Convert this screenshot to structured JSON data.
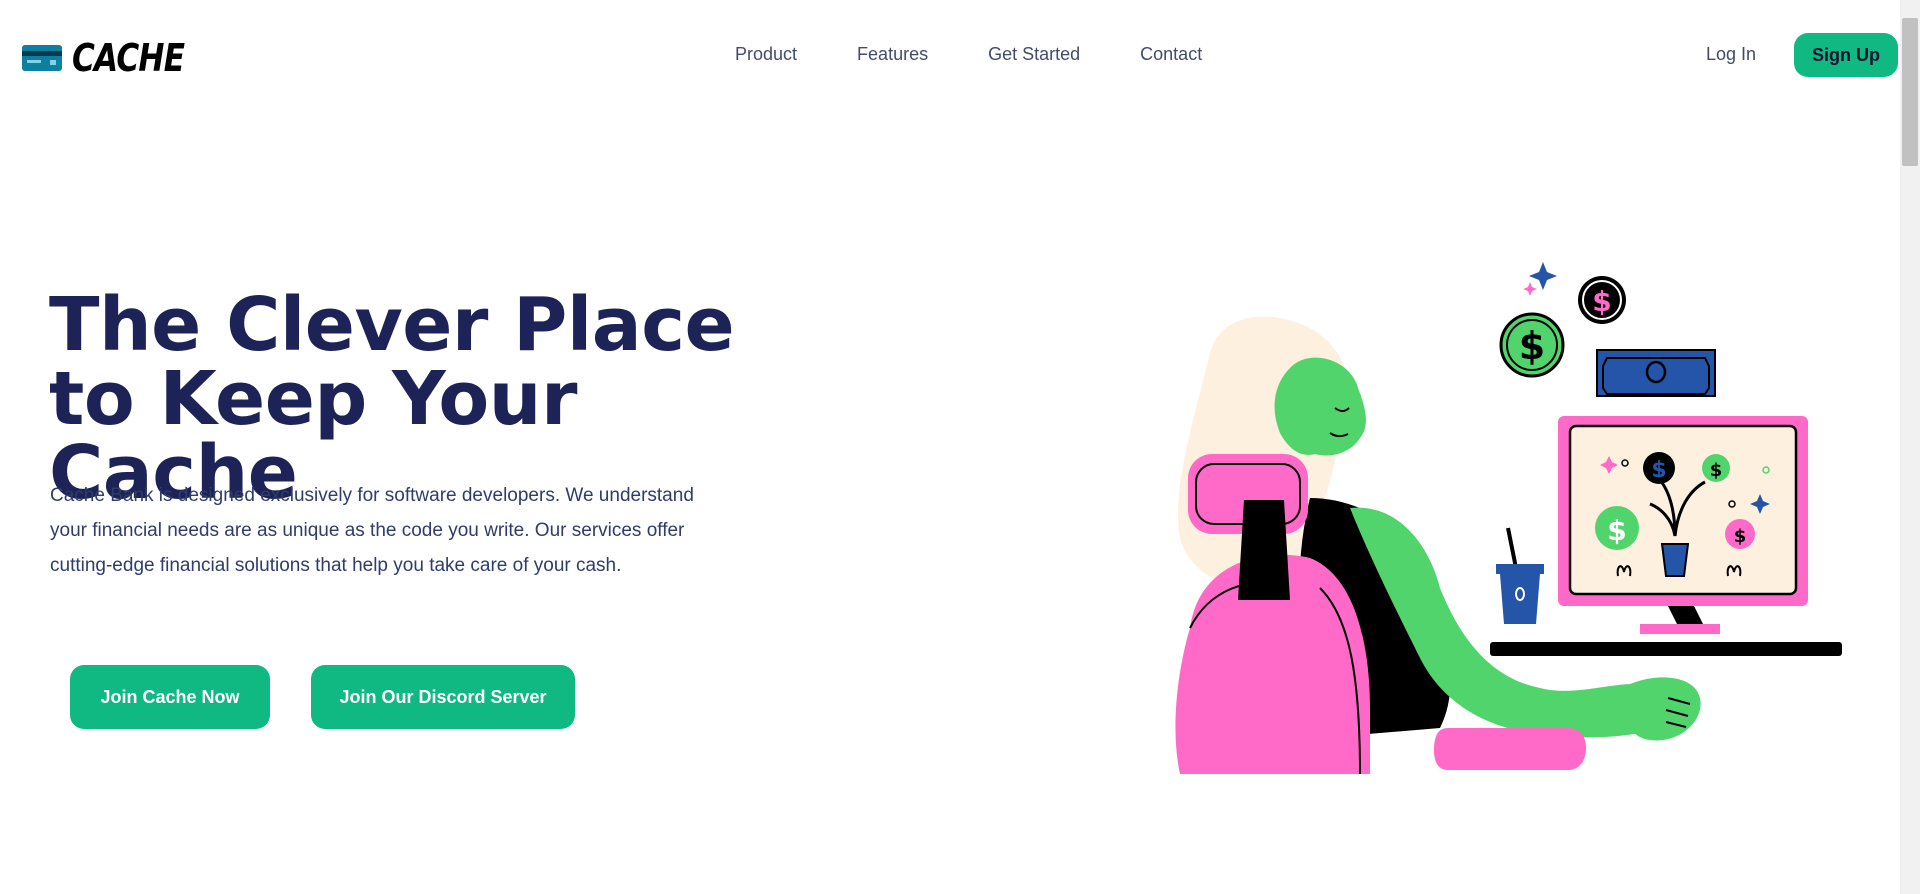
{
  "brand": {
    "name": "CACHE",
    "icon": "credit-card-icon"
  },
  "nav": {
    "links": [
      "Product",
      "Features",
      "Get Started",
      "Contact"
    ],
    "login": "Log In",
    "signup": "Sign Up"
  },
  "hero": {
    "title": "The Clever Place to Keep Your Cache",
    "description": "Cache Bank is designed exclusively for software developers. We understand your financial needs are as unique as the code you write. Our services offer cutting-edge financial solutions that help you take care of your cash.",
    "primary_button": "Join Cache Now",
    "secondary_button": "Join Our Discord Server"
  },
  "colors": {
    "accent": "#10b981",
    "heading": "#1d2356",
    "pink": "#ff6ac8",
    "green": "#52d46d",
    "blue": "#1f56a6"
  },
  "illustration": {
    "icon": "woman-at-computer-illustration"
  }
}
